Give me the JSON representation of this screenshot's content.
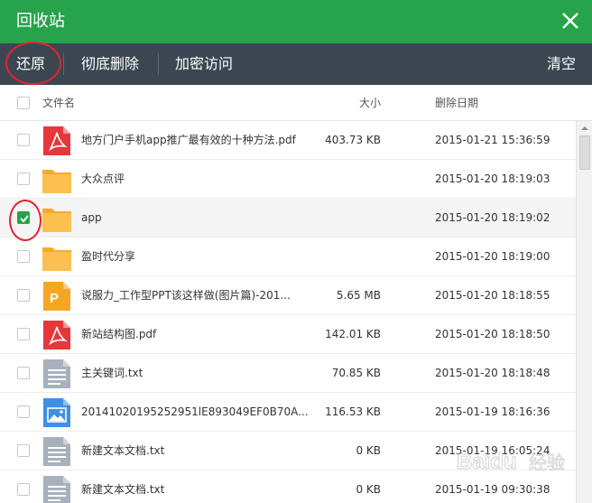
{
  "window": {
    "title": "回收站",
    "close_icon": "close-icon"
  },
  "toolbar": {
    "restore_label": "还原",
    "delete_label": "彻底删除",
    "encrypt_label": "加密访问",
    "clear_label": "清空"
  },
  "table": {
    "columns": {
      "name": "文件名",
      "size": "大小",
      "date": "删除日期"
    },
    "rows": [
      {
        "icon": "pdf-file-icon",
        "name": "地方门户手机app推广最有效的十种方法.pdf",
        "size": "403.73 KB",
        "date": "2015-01-21 15:36:59",
        "checked": false
      },
      {
        "icon": "folder-icon",
        "name": "大众点评",
        "size": "",
        "date": "2015-01-20 18:19:03",
        "checked": false
      },
      {
        "icon": "folder-icon",
        "name": "app",
        "size": "",
        "date": "2015-01-20 18:19:02",
        "checked": true
      },
      {
        "icon": "folder-icon",
        "name": "盈时代分享",
        "size": "",
        "date": "2015-01-20 18:19:00",
        "checked": false
      },
      {
        "icon": "ppt-file-icon",
        "name": "说服力_工作型PPT该这样做(图片篇)-201...",
        "size": "5.65 MB",
        "date": "2015-01-20 18:18:55",
        "checked": false
      },
      {
        "icon": "pdf-file-icon",
        "name": "新站结构图.pdf",
        "size": "142.01 KB",
        "date": "2015-01-20 18:18:50",
        "checked": false
      },
      {
        "icon": "text-file-icon",
        "name": "主关键词.txt",
        "size": "70.85 KB",
        "date": "2015-01-20 18:18:48",
        "checked": false
      },
      {
        "icon": "image-file-icon",
        "name": "20141020195252951lE893049EF0B70A...",
        "size": "116.53 KB",
        "date": "2015-01-19 18:16:36",
        "checked": false
      },
      {
        "icon": "text-file-icon",
        "name": "新建文本文档.txt",
        "size": "0 KB",
        "date": "2015-01-19 16:05:24",
        "checked": false
      },
      {
        "icon": "text-file-icon",
        "name": "新建文本文档.txt",
        "size": "0 KB",
        "date": "2015-01-19 09:30:38",
        "checked": false
      }
    ]
  },
  "colors": {
    "titlebar": "#27a34b",
    "toolbar": "#3b4652",
    "highlight": "#e0252b",
    "check": "#27a34b"
  },
  "watermark": {
    "text": "Baidu 经验"
  }
}
